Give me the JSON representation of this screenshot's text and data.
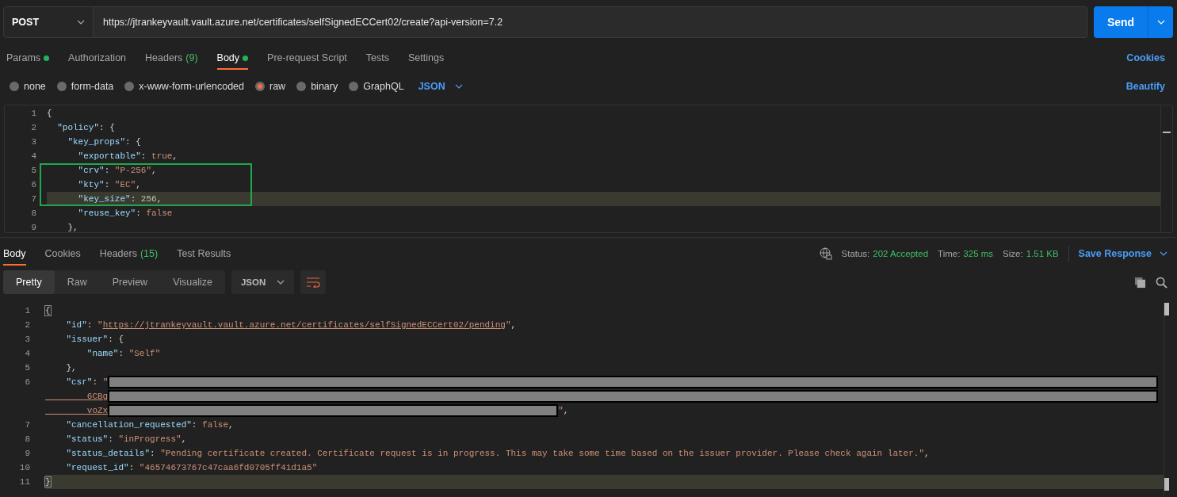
{
  "request": {
    "method": "POST",
    "url": "https://jtrankeyvault.vault.azure.net/certificates/selfSignedECCert02/create?api-version=7.2",
    "send": "Send"
  },
  "request_tabs": [
    {
      "label": "Params",
      "dot": true,
      "selected": false
    },
    {
      "label": "Authorization",
      "dot": false,
      "selected": false
    },
    {
      "label": "Headers",
      "count": "(9)",
      "dot": false,
      "selected": false
    },
    {
      "label": "Body",
      "dot": true,
      "selected": true
    },
    {
      "label": "Pre-request Script",
      "dot": false,
      "selected": false
    },
    {
      "label": "Tests",
      "dot": false,
      "selected": false
    },
    {
      "label": "Settings",
      "dot": false,
      "selected": false
    }
  ],
  "cookies_link": "Cookies",
  "body_types": [
    {
      "label": "none",
      "selected": false
    },
    {
      "label": "form-data",
      "selected": false
    },
    {
      "label": "x-www-form-urlencoded",
      "selected": false
    },
    {
      "label": "raw",
      "selected": true
    },
    {
      "label": "binary",
      "selected": false
    },
    {
      "label": "GraphQL",
      "selected": false
    }
  ],
  "body_format": "JSON",
  "beautify": "Beautify",
  "request_editor": {
    "lines": [
      {
        "n": "1",
        "highlighted": false,
        "boxed": false,
        "tokens": [
          {
            "kind": "punct",
            "t": "{"
          }
        ]
      },
      {
        "n": "2",
        "highlighted": false,
        "boxed": false,
        "tokens": [
          {
            "kind": "key",
            "t": "  \"policy\""
          },
          {
            "kind": "punct",
            "t": ": {"
          }
        ]
      },
      {
        "n": "3",
        "highlighted": false,
        "boxed": false,
        "tokens": [
          {
            "kind": "key",
            "t": "    \"key_props\""
          },
          {
            "kind": "punct",
            "t": ": {"
          }
        ]
      },
      {
        "n": "4",
        "highlighted": false,
        "boxed": false,
        "tokens": [
          {
            "kind": "key",
            "t": "      \"exportable\""
          },
          {
            "kind": "punct",
            "t": ": "
          },
          {
            "kind": "bool",
            "t": "true"
          },
          {
            "kind": "punct",
            "t": ","
          }
        ]
      },
      {
        "n": "5",
        "highlighted": false,
        "boxed": true,
        "tokens": [
          {
            "kind": "key",
            "t": "      \"crv\""
          },
          {
            "kind": "punct",
            "t": ": "
          },
          {
            "kind": "string",
            "t": "\"P-256\""
          },
          {
            "kind": "punct",
            "t": ","
          }
        ]
      },
      {
        "n": "6",
        "highlighted": false,
        "boxed": true,
        "tokens": [
          {
            "kind": "key",
            "t": "      \"kty\""
          },
          {
            "kind": "punct",
            "t": ": "
          },
          {
            "kind": "string",
            "t": "\"EC\""
          },
          {
            "kind": "punct",
            "t": ","
          }
        ]
      },
      {
        "n": "7",
        "highlighted": true,
        "boxed": true,
        "tokens": [
          {
            "kind": "key",
            "t": "      \"key_size\""
          },
          {
            "kind": "punct",
            "t": ": "
          },
          {
            "kind": "number",
            "t": "256"
          },
          {
            "kind": "punct",
            "t": ","
          }
        ]
      },
      {
        "n": "8",
        "highlighted": false,
        "boxed": false,
        "tokens": [
          {
            "kind": "key",
            "t": "      \"reuse_key\""
          },
          {
            "kind": "punct",
            "t": ": "
          },
          {
            "kind": "bool",
            "t": "false"
          }
        ]
      },
      {
        "n": "9",
        "highlighted": false,
        "boxed": false,
        "tokens": [
          {
            "kind": "punct",
            "t": "    },"
          }
        ]
      }
    ]
  },
  "response_tabs": [
    {
      "label": "Body",
      "selected": true
    },
    {
      "label": "Cookies",
      "selected": false
    },
    {
      "label": "Headers",
      "count": "(15)",
      "selected": false
    },
    {
      "label": "Test Results",
      "selected": false
    }
  ],
  "response_status": [
    {
      "label": "Status:",
      "value": "202 Accepted"
    },
    {
      "label": "Time:",
      "value": "325 ms"
    },
    {
      "label": "Size:",
      "value": "1.51 KB"
    }
  ],
  "save_response": "Save Response",
  "view_modes": [
    {
      "label": "Pretty",
      "selected": true
    },
    {
      "label": "Raw",
      "selected": false
    },
    {
      "label": "Preview",
      "selected": false
    },
    {
      "label": "Visualize",
      "selected": false
    }
  ],
  "response_format": "JSON",
  "response_editor": {
    "lines": [
      {
        "n": "1",
        "highlighted": false,
        "tokens": [
          {
            "kind": "bracket",
            "t": "{"
          }
        ]
      },
      {
        "n": "2",
        "highlighted": false,
        "tokens": [
          {
            "kind": "key",
            "t": "    \"id\""
          },
          {
            "kind": "punct",
            "t": ": "
          },
          {
            "kind": "string",
            "t": "\""
          },
          {
            "kind": "link",
            "t": "https://jtrankeyvault.vault.azure.net/certificates/selfSignedECCert02/pending"
          },
          {
            "kind": "string",
            "t": "\""
          },
          {
            "kind": "punct",
            "t": ","
          }
        ]
      },
      {
        "n": "3",
        "highlighted": false,
        "tokens": [
          {
            "kind": "key",
            "t": "    \"issuer\""
          },
          {
            "kind": "punct",
            "t": ": {"
          }
        ]
      },
      {
        "n": "4",
        "highlighted": false,
        "tokens": [
          {
            "kind": "key",
            "t": "        \"name\""
          },
          {
            "kind": "punct",
            "t": ": "
          },
          {
            "kind": "string",
            "t": "\"Self\""
          }
        ]
      },
      {
        "n": "5",
        "highlighted": false,
        "tokens": [
          {
            "kind": "punct",
            "t": "    },"
          }
        ]
      },
      {
        "n": "6",
        "highlighted": false,
        "tokens": [
          {
            "kind": "key",
            "t": "    \"csr\""
          },
          {
            "kind": "punct",
            "t": ": "
          },
          {
            "kind": "string",
            "t": "\""
          },
          {
            "kind": "redacted"
          }
        ]
      },
      {
        "highlighted": false,
        "tokens": [
          {
            "kind": "link",
            "t": "        6CBg"
          },
          {
            "kind": "redacted"
          }
        ]
      },
      {
        "highlighted": false,
        "tokens": [
          {
            "kind": "link",
            "t": "        voZx"
          },
          {
            "kind": "redacted_short"
          },
          {
            "kind": "string",
            "t": "\""
          },
          {
            "kind": "punct",
            "t": ","
          }
        ]
      },
      {
        "n": "7",
        "highlighted": false,
        "tokens": [
          {
            "kind": "key",
            "t": "    \"cancellation_requested\""
          },
          {
            "kind": "punct",
            "t": ": "
          },
          {
            "kind": "bool",
            "t": "false"
          },
          {
            "kind": "punct",
            "t": ","
          }
        ]
      },
      {
        "n": "8",
        "highlighted": false,
        "tokens": [
          {
            "kind": "key",
            "t": "    \"status\""
          },
          {
            "kind": "punct",
            "t": ": "
          },
          {
            "kind": "string",
            "t": "\"inProgress\""
          },
          {
            "kind": "punct",
            "t": ","
          }
        ]
      },
      {
        "n": "9",
        "highlighted": false,
        "tokens": [
          {
            "kind": "key",
            "t": "    \"status_details\""
          },
          {
            "kind": "punct",
            "t": ": "
          },
          {
            "kind": "string",
            "t": "\"Pending certificate created. Certificate request is in progress. This may take some time based on the issuer provider. Please check again later.\""
          },
          {
            "kind": "punct",
            "t": ","
          }
        ]
      },
      {
        "n": "10",
        "highlighted": false,
        "tokens": [
          {
            "kind": "key",
            "t": "    \"request_id\""
          },
          {
            "kind": "punct",
            "t": ": "
          },
          {
            "kind": "string",
            "t": "\"46574673767c47caa6fd0705ff41d1a5\""
          }
        ]
      },
      {
        "n": "11",
        "highlighted": true,
        "tokens": [
          {
            "kind": "bracket",
            "t": "}"
          }
        ]
      }
    ]
  }
}
